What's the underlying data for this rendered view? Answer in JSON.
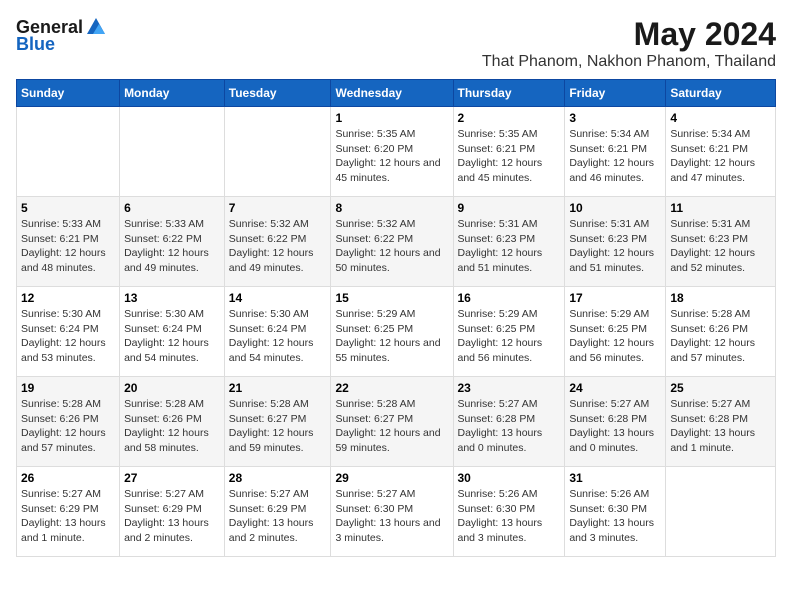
{
  "logo": {
    "general": "General",
    "blue": "Blue"
  },
  "title": "May 2024",
  "subtitle": "That Phanom, Nakhon Phanom, Thailand",
  "weekdays": [
    "Sunday",
    "Monday",
    "Tuesday",
    "Wednesday",
    "Thursday",
    "Friday",
    "Saturday"
  ],
  "weeks": [
    [
      {
        "day": "",
        "info": ""
      },
      {
        "day": "",
        "info": ""
      },
      {
        "day": "",
        "info": ""
      },
      {
        "day": "1",
        "info": "Sunrise: 5:35 AM\nSunset: 6:20 PM\nDaylight: 12 hours\nand 45 minutes."
      },
      {
        "day": "2",
        "info": "Sunrise: 5:35 AM\nSunset: 6:21 PM\nDaylight: 12 hours\nand 45 minutes."
      },
      {
        "day": "3",
        "info": "Sunrise: 5:34 AM\nSunset: 6:21 PM\nDaylight: 12 hours\nand 46 minutes."
      },
      {
        "day": "4",
        "info": "Sunrise: 5:34 AM\nSunset: 6:21 PM\nDaylight: 12 hours\nand 47 minutes."
      }
    ],
    [
      {
        "day": "5",
        "info": "Sunrise: 5:33 AM\nSunset: 6:21 PM\nDaylight: 12 hours\nand 48 minutes."
      },
      {
        "day": "6",
        "info": "Sunrise: 5:33 AM\nSunset: 6:22 PM\nDaylight: 12 hours\nand 49 minutes."
      },
      {
        "day": "7",
        "info": "Sunrise: 5:32 AM\nSunset: 6:22 PM\nDaylight: 12 hours\nand 49 minutes."
      },
      {
        "day": "8",
        "info": "Sunrise: 5:32 AM\nSunset: 6:22 PM\nDaylight: 12 hours\nand 50 minutes."
      },
      {
        "day": "9",
        "info": "Sunrise: 5:31 AM\nSunset: 6:23 PM\nDaylight: 12 hours\nand 51 minutes."
      },
      {
        "day": "10",
        "info": "Sunrise: 5:31 AM\nSunset: 6:23 PM\nDaylight: 12 hours\nand 51 minutes."
      },
      {
        "day": "11",
        "info": "Sunrise: 5:31 AM\nSunset: 6:23 PM\nDaylight: 12 hours\nand 52 minutes."
      }
    ],
    [
      {
        "day": "12",
        "info": "Sunrise: 5:30 AM\nSunset: 6:24 PM\nDaylight: 12 hours\nand 53 minutes."
      },
      {
        "day": "13",
        "info": "Sunrise: 5:30 AM\nSunset: 6:24 PM\nDaylight: 12 hours\nand 54 minutes."
      },
      {
        "day": "14",
        "info": "Sunrise: 5:30 AM\nSunset: 6:24 PM\nDaylight: 12 hours\nand 54 minutes."
      },
      {
        "day": "15",
        "info": "Sunrise: 5:29 AM\nSunset: 6:25 PM\nDaylight: 12 hours\nand 55 minutes."
      },
      {
        "day": "16",
        "info": "Sunrise: 5:29 AM\nSunset: 6:25 PM\nDaylight: 12 hours\nand 56 minutes."
      },
      {
        "day": "17",
        "info": "Sunrise: 5:29 AM\nSunset: 6:25 PM\nDaylight: 12 hours\nand 56 minutes."
      },
      {
        "day": "18",
        "info": "Sunrise: 5:28 AM\nSunset: 6:26 PM\nDaylight: 12 hours\nand 57 minutes."
      }
    ],
    [
      {
        "day": "19",
        "info": "Sunrise: 5:28 AM\nSunset: 6:26 PM\nDaylight: 12 hours\nand 57 minutes."
      },
      {
        "day": "20",
        "info": "Sunrise: 5:28 AM\nSunset: 6:26 PM\nDaylight: 12 hours\nand 58 minutes."
      },
      {
        "day": "21",
        "info": "Sunrise: 5:28 AM\nSunset: 6:27 PM\nDaylight: 12 hours\nand 59 minutes."
      },
      {
        "day": "22",
        "info": "Sunrise: 5:28 AM\nSunset: 6:27 PM\nDaylight: 12 hours\nand 59 minutes."
      },
      {
        "day": "23",
        "info": "Sunrise: 5:27 AM\nSunset: 6:28 PM\nDaylight: 13 hours\nand 0 minutes."
      },
      {
        "day": "24",
        "info": "Sunrise: 5:27 AM\nSunset: 6:28 PM\nDaylight: 13 hours\nand 0 minutes."
      },
      {
        "day": "25",
        "info": "Sunrise: 5:27 AM\nSunset: 6:28 PM\nDaylight: 13 hours\nand 1 minute."
      }
    ],
    [
      {
        "day": "26",
        "info": "Sunrise: 5:27 AM\nSunset: 6:29 PM\nDaylight: 13 hours\nand 1 minute."
      },
      {
        "day": "27",
        "info": "Sunrise: 5:27 AM\nSunset: 6:29 PM\nDaylight: 13 hours\nand 2 minutes."
      },
      {
        "day": "28",
        "info": "Sunrise: 5:27 AM\nSunset: 6:29 PM\nDaylight: 13 hours\nand 2 minutes."
      },
      {
        "day": "29",
        "info": "Sunrise: 5:27 AM\nSunset: 6:30 PM\nDaylight: 13 hours\nand 3 minutes."
      },
      {
        "day": "30",
        "info": "Sunrise: 5:26 AM\nSunset: 6:30 PM\nDaylight: 13 hours\nand 3 minutes."
      },
      {
        "day": "31",
        "info": "Sunrise: 5:26 AM\nSunset: 6:30 PM\nDaylight: 13 hours\nand 3 minutes."
      },
      {
        "day": "",
        "info": ""
      }
    ]
  ]
}
